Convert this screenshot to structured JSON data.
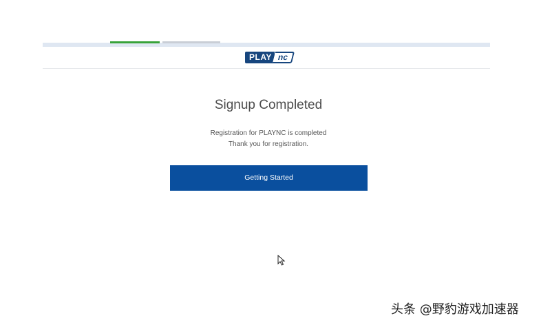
{
  "progress": {
    "steps_completed": 1,
    "done_color": "#38a33a",
    "pending_color": "#c9ced6"
  },
  "logo": {
    "part1": "PLAY",
    "part2": "nc",
    "color": "#17467e"
  },
  "main": {
    "title": "Signup Completed",
    "message_line1": "Registration for PLAYNC is completed",
    "message_line2": "Thank you for registration.",
    "button_label": "Getting Started",
    "button_color": "#0a4f9e"
  },
  "watermark": {
    "text": "头条 @野豹游戏加速器"
  },
  "cursor": {
    "icon": "mouse-pointer-icon"
  }
}
